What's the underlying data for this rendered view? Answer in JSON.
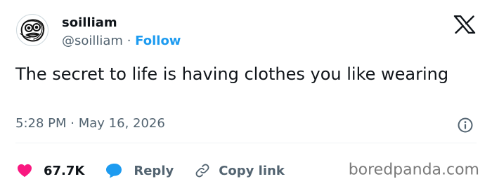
{
  "user": {
    "display_name": "soilliam",
    "handle": "@soilliam",
    "separator": "·",
    "follow_label": "Follow",
    "avatar_icon": "scribble-face-avatar"
  },
  "brand": {
    "logo_icon": "x-logo"
  },
  "tweet": {
    "text": "The secret to life is having clothes you like wearing",
    "time": "5:28 PM",
    "separator": "·",
    "date": "May 16, 2026",
    "info_icon": "info-icon"
  },
  "actions": {
    "like_count": "67.7K",
    "like_icon": "heart-icon",
    "reply_label": "Reply",
    "reply_icon": "speech-bubble-icon",
    "copy_link_label": "Copy link",
    "copy_link_icon": "link-icon"
  },
  "watermark": "boredpanda.com",
  "colors": {
    "accent": "#1d9bf0",
    "like": "#f91880",
    "text": "#0f1419",
    "secondary": "#536471",
    "watermark": "#7a7a7a"
  }
}
